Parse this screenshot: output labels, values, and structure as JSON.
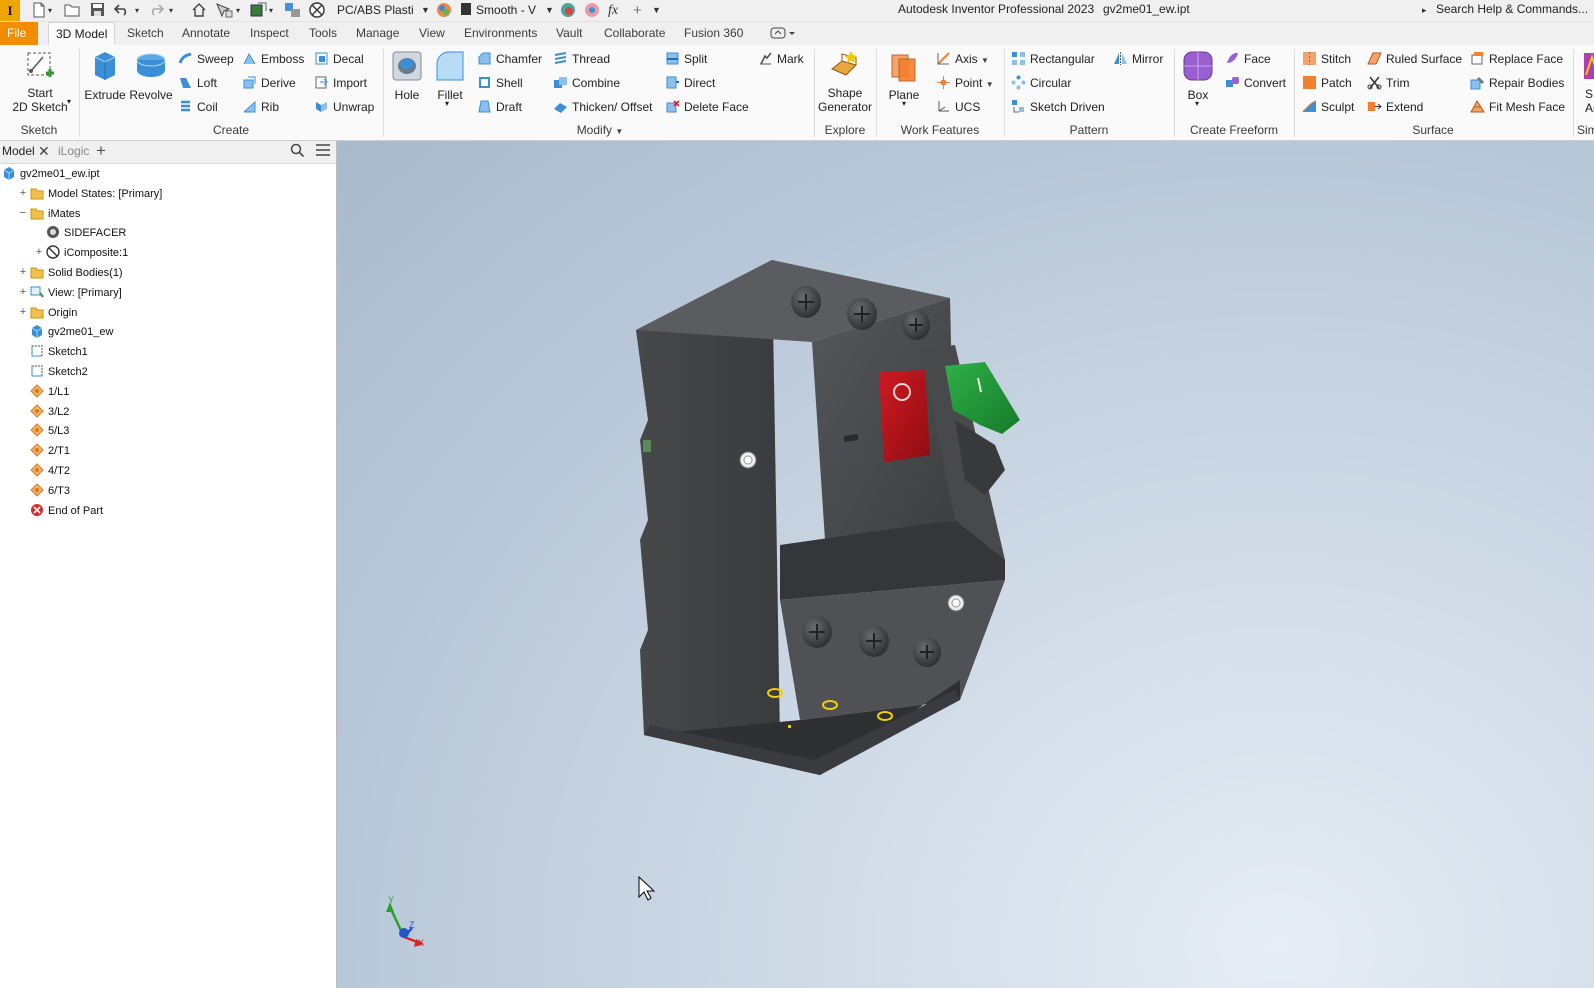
{
  "titlebar": {
    "app_logo": "I",
    "material": "PC/ABS Plasti",
    "appearance": "Smooth - V",
    "fx": "fx",
    "app_name": "Autodesk Inventor Professional 2023",
    "file_name": "gv2me01_ew.ipt",
    "search": "Search Help & Commands..."
  },
  "tabs": [
    "File",
    "3D Model",
    "Sketch",
    "Annotate",
    "Inspect",
    "Tools",
    "Manage",
    "View",
    "Environments",
    "Vault",
    "Collaborate",
    "Fusion 360"
  ],
  "active_tab": "3D Model",
  "ribbon": {
    "sketch": {
      "label": "Sketch",
      "start_line1": "Start",
      "start_line2": "2D Sketch"
    },
    "create": {
      "label": "Create",
      "extrude": "Extrude",
      "revolve": "Revolve",
      "sweep": "Sweep",
      "loft": "Loft",
      "coil": "Coil",
      "emboss": "Emboss",
      "derive": "Derive",
      "rib": "Rib",
      "decal": "Decal",
      "import": "Import",
      "unwrap": "Unwrap"
    },
    "modify": {
      "label": "Modify",
      "hole": "Hole",
      "fillet": "Fillet",
      "chamfer": "Chamfer",
      "shell": "Shell",
      "draft": "Draft",
      "thread": "Thread",
      "combine": "Combine",
      "thicken": "Thicken/ Offset",
      "split": "Split",
      "direct": "Direct",
      "delete_face": "Delete Face",
      "mark": "Mark"
    },
    "explore": {
      "label": "Explore",
      "shape_line1": "Shape",
      "shape_line2": "Generator"
    },
    "work_features": {
      "label": "Work Features",
      "plane": "Plane",
      "axis": "Axis",
      "point": "Point",
      "ucs": "UCS"
    },
    "pattern": {
      "label": "Pattern",
      "rectangular": "Rectangular",
      "circular": "Circular",
      "sketch_driven": "Sketch Driven",
      "mirror": "Mirror"
    },
    "freeform": {
      "label": "Create Freeform",
      "box": "Box",
      "face": "Face",
      "convert": "Convert"
    },
    "surface": {
      "label": "Surface",
      "stitch": "Stitch",
      "patch": "Patch",
      "sculpt": "Sculpt",
      "ruled_surface": "Ruled Surface",
      "trim": "Trim",
      "extend": "Extend",
      "replace_face": "Replace Face",
      "repair_bodies": "Repair Bodies",
      "fit_mesh_face": "Fit Mesh Face"
    },
    "simulation": {
      "label": "Sim",
      "btn_line1": "S",
      "btn_line2": "Ar"
    }
  },
  "browser": {
    "tab_model": "Model",
    "tab_ilogic": "iLogic",
    "tree": [
      {
        "label": "gv2me01_ew.ipt",
        "icon": "part-icon"
      },
      {
        "label": "Model States: [Primary]",
        "icon": "folder-icon"
      },
      {
        "label": "iMates",
        "icon": "folder-icon"
      },
      {
        "label": "SIDEFACER",
        "icon": "imate-icon"
      },
      {
        "label": "iComposite:1",
        "icon": "icomposite-icon"
      },
      {
        "label": "Solid Bodies(1)",
        "icon": "folder-icon"
      },
      {
        "label": "View: [Primary]",
        "icon": "view-icon"
      },
      {
        "label": "Origin",
        "icon": "folder-icon"
      },
      {
        "label": "gv2me01_ew",
        "icon": "part-icon"
      },
      {
        "label": "Sketch1",
        "icon": "sketch-icon"
      },
      {
        "label": "Sketch2",
        "icon": "sketch-icon"
      },
      {
        "label": "1/L1",
        "icon": "workpoint-icon"
      },
      {
        "label": "3/L2",
        "icon": "workpoint-icon"
      },
      {
        "label": "5/L3",
        "icon": "workpoint-icon"
      },
      {
        "label": "2/T1",
        "icon": "workpoint-icon"
      },
      {
        "label": "4/T2",
        "icon": "workpoint-icon"
      },
      {
        "label": "6/T3",
        "icon": "workpoint-icon"
      },
      {
        "label": "End of Part",
        "icon": "end-of-part-icon"
      }
    ]
  },
  "viewport": {
    "switch_on_symbol": "I",
    "switch_off_symbol": "O",
    "axis_x": "X",
    "axis_y": "Y",
    "axis_z": "Z"
  },
  "colors": {
    "file_tab": "#f28c00",
    "model_body": "#4a4b4d",
    "off_button": "#c0141b",
    "on_button": "#1d9a35",
    "terminal_marks": "#f0d000"
  }
}
